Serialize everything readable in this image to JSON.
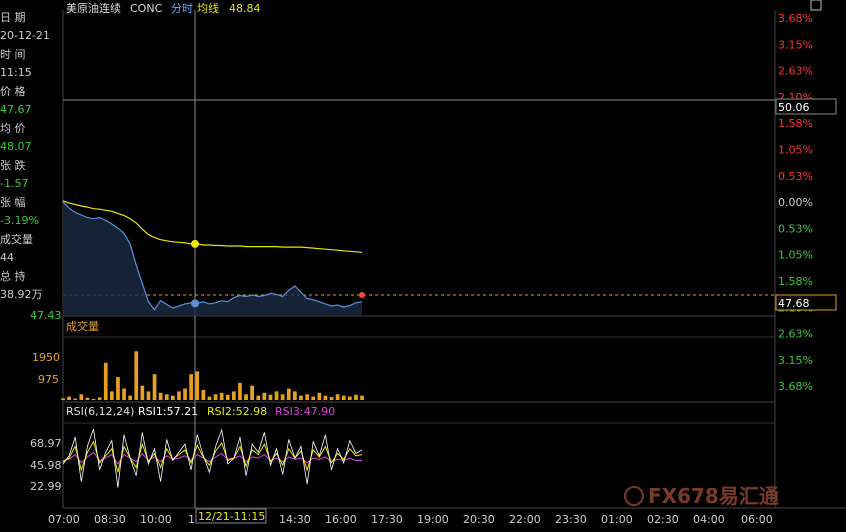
{
  "header": {
    "title": "美原油连续",
    "code": "CONC",
    "mode": "分时",
    "ma_label": "均线",
    "ma_value": "48.84"
  },
  "info_panel": [
    {
      "label": "日 期",
      "value": "20-12-21",
      "value_color": "#cccccc"
    },
    {
      "label": "时 间",
      "value": "11:15",
      "value_color": "#cccccc"
    },
    {
      "label": "价 格",
      "value": "47.67",
      "value_color": "#33cc33"
    },
    {
      "label": "均 价",
      "value": "48.07",
      "value_color": "#33cc33"
    },
    {
      "label": "张 跌",
      "value": "-1.57",
      "value_color": "#33cc33"
    },
    {
      "label": "张 幅",
      "value": "-3.19%",
      "value_color": "#33cc33"
    },
    {
      "label": "成交量",
      "value": "44",
      "value_color": "#cccccc"
    },
    {
      "label": "总 持",
      "value": "38.92万",
      "value_color": "#cccccc"
    }
  ],
  "price_axis": {
    "pct_labels_up": [
      "3.68%",
      "3.15%",
      "2.63%",
      "2.10%",
      "1.58%",
      "1.05%",
      "0.53%"
    ],
    "zero_label": "0.00%",
    "pct_labels_down": [
      "0.53%",
      "1.05%",
      "1.58%",
      "2.10%",
      "2.63%",
      "3.15%",
      "3.68%"
    ],
    "crosshair_price": "50.06",
    "last_price": "47.68",
    "left_low_label": "47.43"
  },
  "volume_panel": {
    "title": "成交量",
    "y_labels": [
      "1950",
      "975"
    ]
  },
  "rsi_panel": {
    "title": "RSI(6,12,24)",
    "rsi1": "RSI1:57.21",
    "rsi2": "RSI2:52.98",
    "rsi3": "RSI3:47.90",
    "y_labels": [
      "68.97",
      "45.98",
      "22.99"
    ]
  },
  "time_axis": {
    "labels": [
      "07:00",
      "08:30",
      "10:00",
      "1",
      "14:30",
      "16:00",
      "17:30",
      "19:00",
      "20:30",
      "22:00",
      "23:30",
      "01:00",
      "02:30",
      "04:00",
      "06:00"
    ],
    "crosshair_label": "12/21-11:15"
  },
  "watermark": "FX678易汇通",
  "colors": {
    "price_line": "#5b8fd8",
    "avg_line": "#e8e800",
    "volume": "#e8a020",
    "rsi1": "#ffffff",
    "rsi2": "#e8e800",
    "rsi3": "#e040e0",
    "up": "#ff3030",
    "down": "#33cc33",
    "last_price_line": "#e8a020"
  },
  "chart_data": {
    "type": "line",
    "x_range": [
      "07:00",
      "06:00"
    ],
    "series": [
      {
        "values": [
          49.6,
          49.48,
          49.4,
          49.35,
          49.3,
          49.28,
          49.3,
          49.25,
          49.18,
          49.1,
          49.0,
          48.8,
          48.4,
          48.05,
          47.7,
          47.55,
          47.72,
          47.65,
          47.58,
          47.62,
          47.66,
          47.68,
          47.67,
          47.7,
          47.66,
          47.68,
          47.72,
          47.7,
          47.78,
          47.82,
          47.8,
          47.83,
          47.8,
          47.82,
          47.86,
          47.84,
          47.8,
          47.92,
          48.0,
          47.88,
          47.76,
          47.74,
          47.7,
          47.66,
          47.62,
          47.64,
          47.6,
          47.63,
          47.68,
          47.7
        ]
      },
      {
        "values": [
          49.62,
          49.58,
          49.55,
          49.52,
          49.5,
          49.47,
          49.46,
          49.44,
          49.42,
          49.38,
          49.34,
          49.28,
          49.2,
          49.08,
          48.98,
          48.92,
          48.88,
          48.86,
          48.84,
          48.83,
          48.82,
          48.8,
          48.8,
          48.78,
          48.78,
          48.77,
          48.77,
          48.76,
          48.76,
          48.76,
          48.75,
          48.75,
          48.75,
          48.75,
          48.75,
          48.75,
          48.74,
          48.74,
          48.74,
          48.74,
          48.73,
          48.72,
          48.71,
          48.7,
          48.69,
          48.68,
          48.67,
          48.66,
          48.65,
          48.64
        ]
      }
    ],
    "volume": [
      60,
      120,
      50,
      200,
      80,
      40,
      90,
      1300,
      300,
      800,
      400,
      150,
      1700,
      500,
      300,
      900,
      250,
      200,
      150,
      300,
      400,
      900,
      1000,
      350,
      120,
      200,
      250,
      180,
      300,
      600,
      200,
      500,
      150,
      250,
      180,
      300,
      200,
      400,
      300,
      150,
      200,
      120,
      250,
      150,
      100,
      200,
      150,
      120,
      180,
      150
    ],
    "rsi1": [
      45,
      52,
      68,
      30,
      60,
      75,
      40,
      55,
      65,
      25,
      70,
      50,
      35,
      72,
      45,
      58,
      30,
      66,
      48,
      55,
      62,
      40,
      70,
      52,
      38,
      60,
      74,
      45,
      50,
      68,
      35,
      62,
      55,
      72,
      44,
      58,
      36,
      66,
      50,
      60,
      28,
      64,
      52,
      70,
      40,
      58,
      46,
      65,
      54,
      57
    ],
    "rsi2": [
      47,
      50,
      60,
      40,
      55,
      64,
      46,
      52,
      58,
      38,
      60,
      50,
      42,
      62,
      47,
      54,
      42,
      58,
      49,
      53,
      57,
      46,
      61,
      51,
      44,
      56,
      63,
      48,
      50,
      60,
      43,
      57,
      53,
      62,
      47,
      54,
      44,
      58,
      50,
      56,
      40,
      57,
      51,
      60,
      46,
      54,
      49,
      58,
      52,
      53
    ],
    "rsi3": [
      48,
      49,
      53,
      46,
      51,
      55,
      48,
      50,
      53,
      45,
      53,
      50,
      47,
      54,
      48,
      51,
      47,
      52,
      49,
      50,
      52,
      48,
      53,
      50,
      47,
      51,
      54,
      49,
      50,
      52,
      47,
      51,
      50,
      53,
      48,
      50,
      47,
      51,
      49,
      50,
      46,
      50,
      49,
      51,
      47,
      49,
      48,
      50,
      48,
      48
    ]
  }
}
